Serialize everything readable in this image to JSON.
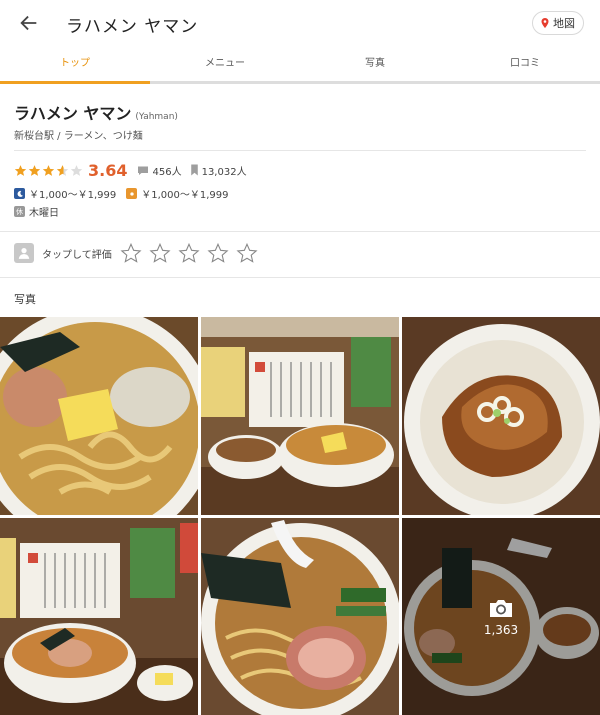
{
  "header": {
    "title": "ラハメン ヤマン",
    "map_label": "地図"
  },
  "tabs": [
    {
      "label": "トップ",
      "active": true
    },
    {
      "label": "メニュー",
      "active": false
    },
    {
      "label": "写真",
      "active": false
    },
    {
      "label": "口コミ",
      "active": false
    }
  ],
  "shop": {
    "name": "ラハメン ヤマン",
    "romaji": "(Yahman)",
    "genre": "新桜台駅 / ラーメン、つけ麺",
    "rating": "3.64",
    "rating_value": 3.64,
    "reviews": "456人",
    "bookmarks": "13,032人",
    "dinner_price": "￥1,000～￥1,999",
    "lunch_price": "￥1,000～￥1,999",
    "holiday": "木曜日",
    "holiday_icon_text": "休"
  },
  "my_rating": {
    "prompt": "タップして評価",
    "stars": 5
  },
  "photos": {
    "label": "写真",
    "count": "1,363"
  },
  "colors": {
    "accent": "#f0a020",
    "score": "#e0602c",
    "star": "#f0a020",
    "dinner": "#2d5a9e",
    "lunch": "#e8962e"
  }
}
